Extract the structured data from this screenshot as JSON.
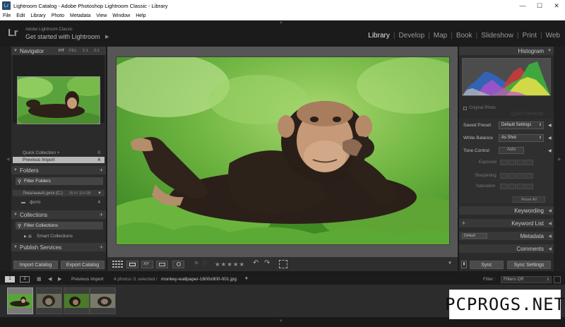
{
  "window": {
    "title": "Lightroom Catalog - Adobe Photoshop Lightroom Classic - Library",
    "app_icon": "Lr"
  },
  "menu": [
    "File",
    "Edit",
    "Library",
    "Photo",
    "Metadata",
    "View",
    "Window",
    "Help"
  ],
  "identity": {
    "logo": "Lr",
    "brand": "Adobe Lightroom Classic",
    "tagline": "Get started with Lightroom",
    "arrow": "▶"
  },
  "modules": [
    "Library",
    "Develop",
    "Map",
    "Book",
    "Slideshow",
    "Print",
    "Web"
  ],
  "active_module": "Library",
  "navigator": {
    "title": "Navigator",
    "zoom": [
      "FIT",
      "FILL",
      "1:1",
      "2:1"
    ]
  },
  "catalog": [
    {
      "label": "Quick Collection +",
      "count": "0"
    },
    {
      "label": "Previous Import",
      "count": "4"
    }
  ],
  "folders": {
    "title": "Folders",
    "filter": "Filter Folders",
    "disk": {
      "label": "Локальный диск (C:)",
      "size": "26.4 / 119 GB"
    },
    "items": [
      {
        "label": "фото",
        "count": "4"
      }
    ]
  },
  "collections": {
    "title": "Collections",
    "filter": "Filter Collections",
    "items": [
      {
        "label": "Smart Collections"
      }
    ]
  },
  "publish": {
    "title": "Publish Services"
  },
  "left_buttons": {
    "import": "Import Catalog",
    "export": "Export Catalog"
  },
  "histogram": {
    "title": "Histogram",
    "original_photo": "Original Photo"
  },
  "quick_develop": {
    "title": "Quick Develop",
    "saved_preset_label": "Saved Preset",
    "saved_preset_value": "Default Settings",
    "white_balance_label": "White Balance",
    "white_balance_value": "As Shot",
    "tone_control_label": "Tone Control",
    "auto": "Auto",
    "exposure": "Exposure",
    "sharpening": "Sharpening",
    "saturation": "Saturation",
    "reset": "Reset All"
  },
  "right_panels": {
    "keywording": "Keywording",
    "keyword_list": "Keyword List",
    "metadata": "Metadata",
    "metadata_preset": "Default",
    "comments": "Comments"
  },
  "right_buttons": {
    "sync": "Sync",
    "sync_settings": "Sync Settings"
  },
  "filmbar": {
    "pages": [
      "1",
      "2"
    ],
    "source": "Previous Import",
    "info": "4 photos /1 selected /",
    "filename": "monkey-wallpaper-1600x900-001.jpg",
    "filter_label": "Filter :",
    "filter_value": "Filters Off"
  },
  "rating": "★★★★★",
  "watermark": "PCPROGS.NET"
}
